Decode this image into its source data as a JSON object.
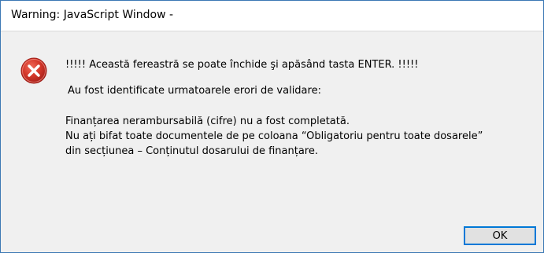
{
  "window": {
    "title": "Warning: JavaScript Window -"
  },
  "dialog": {
    "icon": "error-icon",
    "icon_color": "#c42b1c",
    "headline": "!!!!! Această fereastră se poate închide şi apăsând tasta ENTER. !!!!!",
    "intro": "Au fost identificate urmatoarele erori de validare:",
    "errors": [
      "Finanțarea nerambursabilă (cifre) nu a fost completată.",
      "Nu ați bifat toate documentele de pe coloana “Obligatoriu pentru toate dosarele”",
      "din secțiunea – Conținutul dosarului de finanțare."
    ]
  },
  "buttons": {
    "ok_label": "OK"
  },
  "colors": {
    "accent": "#0078d7",
    "window_border": "#3c78b4"
  }
}
